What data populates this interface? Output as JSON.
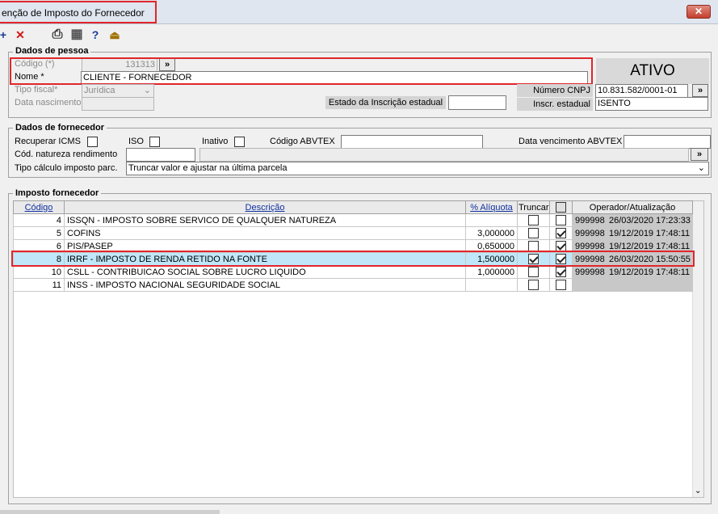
{
  "window": {
    "title": "enção de Imposto do Fornecedor",
    "close_label": "✕"
  },
  "toolbar": {
    "add": "+",
    "delete": "✕",
    "print": "⎙",
    "grid": "▦",
    "help": "?",
    "exit": "⏏"
  },
  "pessoa": {
    "legend": "Dados de pessoa",
    "codigo_label": "Código (*)",
    "codigo_value": "131313",
    "codigo_btn": "»",
    "nome_label": "Nome *",
    "nome_value": "CLIENTE - FORNECEDOR",
    "status": "ATIVO",
    "tipo_fiscal_label": "Tipo fiscal*",
    "tipo_fiscal_value": "Jurídica",
    "data_nasc_label": "Data nascimento",
    "estado_ie_label": "Estado da Inscrição estadual",
    "cnpj_label": "Número CNPJ",
    "cnpj_value": "10.831.582/0001-01",
    "cnpj_btn": "»",
    "ie_label": "Inscr. estadual",
    "ie_value": "ISENTO"
  },
  "fornecedor": {
    "legend": "Dados de fornecedor",
    "recuperar_icms": "Recuperar ICMS",
    "iso": "ISO",
    "inativo": "Inativo",
    "codigo_abvtex": "Código ABVTEX",
    "data_venc_abvtex": "Data vencimento ABVTEX",
    "cod_natureza": "Cód. natureza rendimento",
    "cod_btn": "»",
    "tipo_calc_label": "Tipo cálculo imposto parc.",
    "tipo_calc_value": "Truncar valor e ajustar na última parcela"
  },
  "imposto": {
    "legend": "Imposto fornecedor",
    "headers": {
      "codigo": "Código",
      "descricao": "Descrição",
      "aliquota": "% Alíquota",
      "truncar": "Truncar",
      "operador": "Operador/Atualização"
    },
    "rows": [
      {
        "codigo": "4",
        "descricao": "ISSQN - IMPOSTO SOBRE SERVICO DE QUALQUER NATUREZA",
        "aliquota": "",
        "truncar": false,
        "sel": false,
        "operador": "999998",
        "data": "26/03/2020 17:23:33"
      },
      {
        "codigo": "5",
        "descricao": "COFINS",
        "aliquota": "3,000000",
        "truncar": false,
        "sel": true,
        "operador": "999998",
        "data": "19/12/2019 17:48:11"
      },
      {
        "codigo": "6",
        "descricao": "PIS/PASEP",
        "aliquota": "0,650000",
        "truncar": false,
        "sel": true,
        "operador": "999998",
        "data": "19/12/2019 17:48:11"
      },
      {
        "codigo": "8",
        "descricao": "IRRF - IMPOSTO DE RENDA RETIDO NA FONTE",
        "aliquota": "1,500000",
        "truncar": true,
        "sel": true,
        "operador": "999998",
        "data": "26/03/2020 15:50:55"
      },
      {
        "codigo": "10",
        "descricao": "CSLL - CONTRIBUICAO SOCIAL SOBRE LUCRO LIQUIDO",
        "aliquota": "1,000000",
        "truncar": false,
        "sel": true,
        "operador": "999998",
        "data": "19/12/2019 17:48:11"
      },
      {
        "codigo": "11",
        "descricao": "INSS - IMPOSTO NACIONAL SEGURIDADE SOCIAL",
        "aliquota": "",
        "truncar": false,
        "sel": false,
        "operador": "",
        "data": ""
      }
    ]
  },
  "colors": {
    "highlight": "#bfe7f9",
    "red": "#e0262b"
  }
}
